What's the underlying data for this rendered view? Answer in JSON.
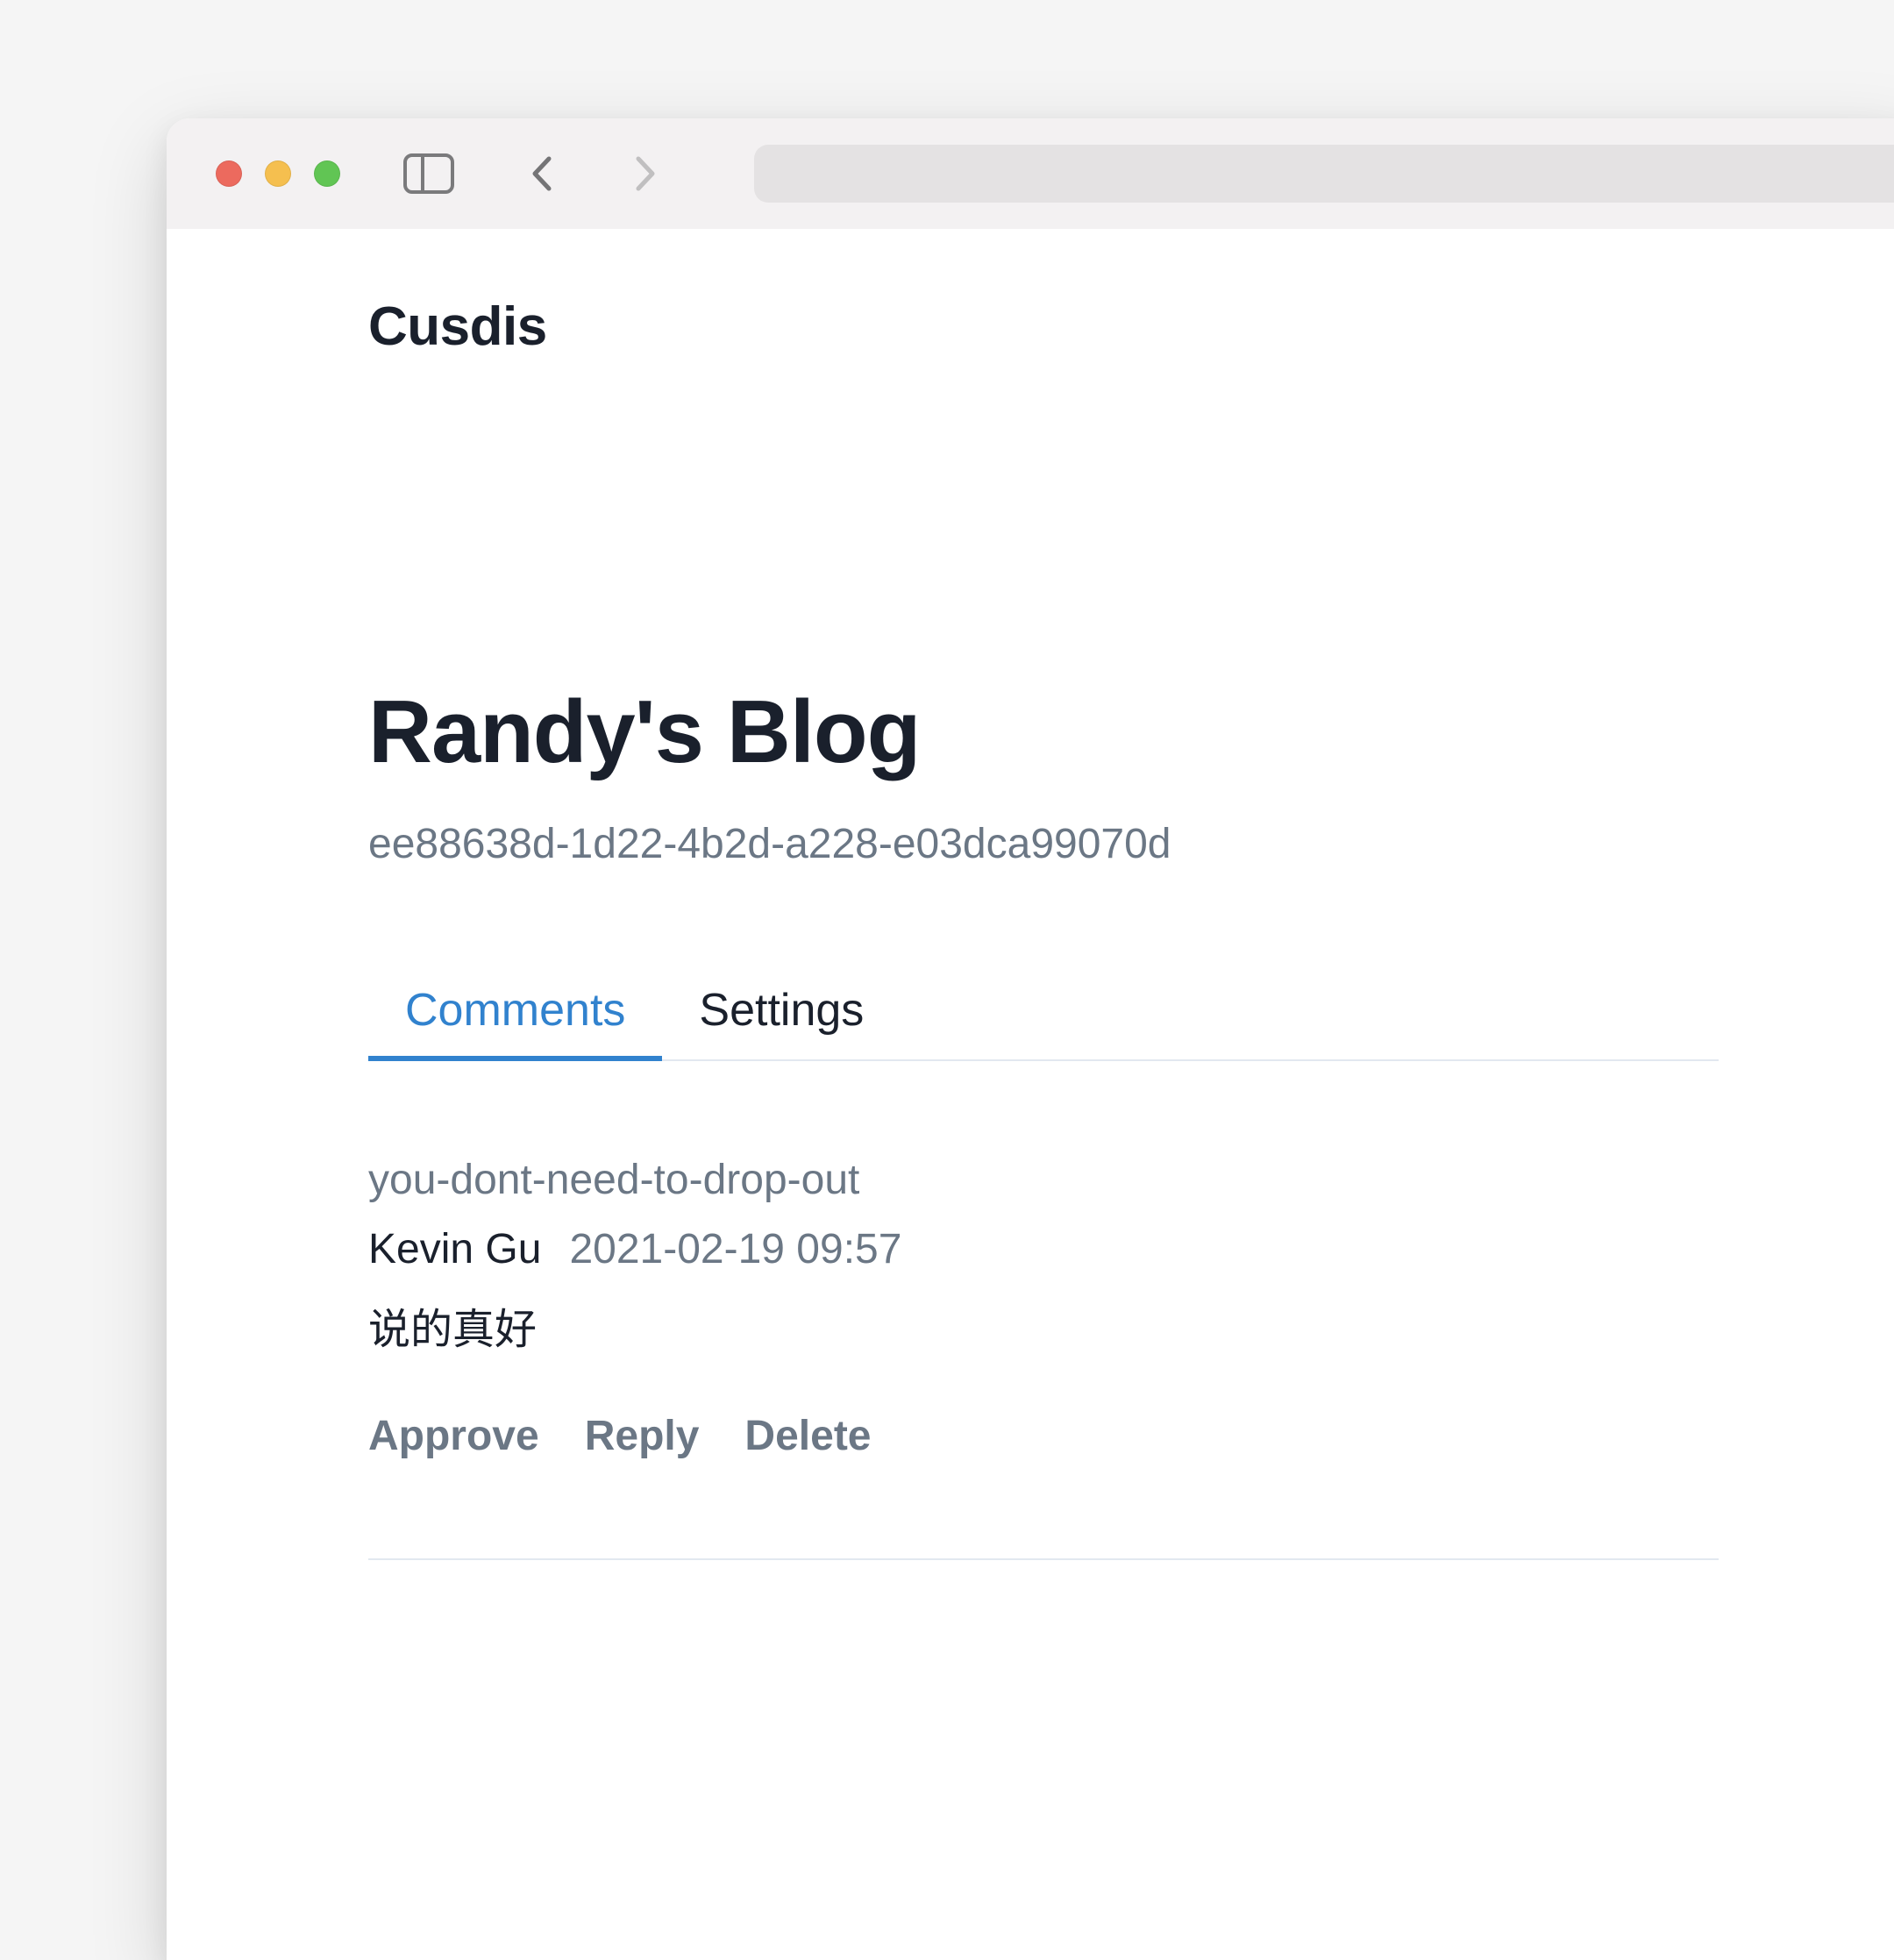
{
  "app": {
    "name": "Cusdis"
  },
  "blog": {
    "title": "Randy's Blog",
    "id": "ee88638d-1d22-4b2d-a228-e03dca99070d"
  },
  "tabs": [
    {
      "label": "Comments",
      "active": true
    },
    {
      "label": "Settings",
      "active": false
    }
  ],
  "comments": [
    {
      "slug": "you-dont-need-to-drop-out",
      "author": "Kevin Gu",
      "date": "2021-02-19 09:57",
      "body": "说的真好",
      "actions": {
        "approve": "Approve",
        "reply": "Reply",
        "delete": "Delete"
      }
    }
  ]
}
